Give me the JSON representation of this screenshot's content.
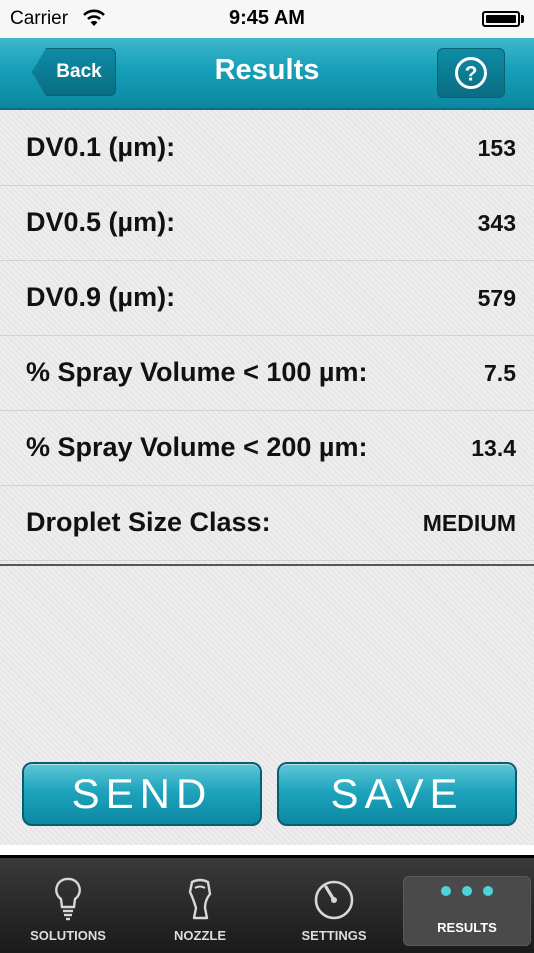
{
  "status_bar": {
    "carrier": "Carrier",
    "time": "9:45 AM"
  },
  "nav": {
    "back_label": "Back",
    "title": "Results",
    "help_symbol": "?"
  },
  "results": [
    {
      "label": "DV0.1 (µm):",
      "value": "153"
    },
    {
      "label": "DV0.5 (µm):",
      "value": "343"
    },
    {
      "label": "DV0.9 (µm):",
      "value": "579"
    },
    {
      "label": "% Spray Volume < 100 µm:",
      "value": "7.5"
    },
    {
      "label": "% Spray Volume < 200 µm:",
      "value": "13.4"
    },
    {
      "label": "Droplet Size Class:",
      "value": "MEDIUM"
    }
  ],
  "actions": {
    "send_label": "SEND",
    "save_label": "SAVE"
  },
  "tabs": [
    {
      "label": "SOLUTIONS",
      "icon": "lightbulb-icon"
    },
    {
      "label": "NOZZLE",
      "icon": "nozzle-icon"
    },
    {
      "label": "SETTINGS",
      "icon": "gauge-icon"
    },
    {
      "label": "RESULTS",
      "icon": "dots-icon",
      "active": true
    }
  ],
  "colors": {
    "accent": "#169fb8",
    "accent_dark": "#0a6d82",
    "dot_color": "#4fd3d9"
  }
}
